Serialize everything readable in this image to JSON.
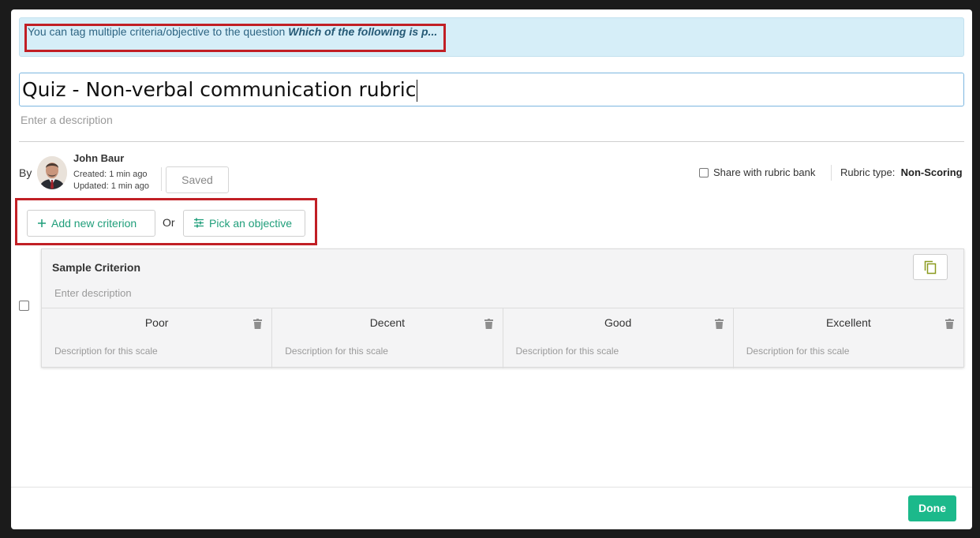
{
  "banner": {
    "text": "You can tag multiple criteria/objective to the question",
    "question": "Which of the following is p..."
  },
  "rubric": {
    "title": "Quiz - Non-verbal communication rubric",
    "description_placeholder": "Enter a description"
  },
  "author": {
    "by_label": "By",
    "name": "John Baur",
    "created": "Created: 1 min ago",
    "updated": "Updated: 1 min ago",
    "saved_label": "Saved"
  },
  "options": {
    "share_label": "Share with rubric bank",
    "share_checked": false,
    "rubric_type_label": "Rubric type:",
    "rubric_type_value": "Non-Scoring"
  },
  "actions": {
    "add_label": "Add new criterion",
    "or_label": "Or",
    "pick_label": "Pick an objective"
  },
  "criterion": {
    "title": "Sample Criterion",
    "description_placeholder": "Enter description",
    "scales": [
      {
        "name": "Poor",
        "desc": "Description for this scale"
      },
      {
        "name": "Decent",
        "desc": "Description for this scale"
      },
      {
        "name": "Good",
        "desc": "Description for this scale"
      },
      {
        "name": "Excellent",
        "desc": "Description for this scale"
      }
    ]
  },
  "footer": {
    "done_label": "Done"
  },
  "colors": {
    "accent": "#1cb98b",
    "highlight": "#c11f25",
    "banner_bg": "#d6eef8"
  }
}
